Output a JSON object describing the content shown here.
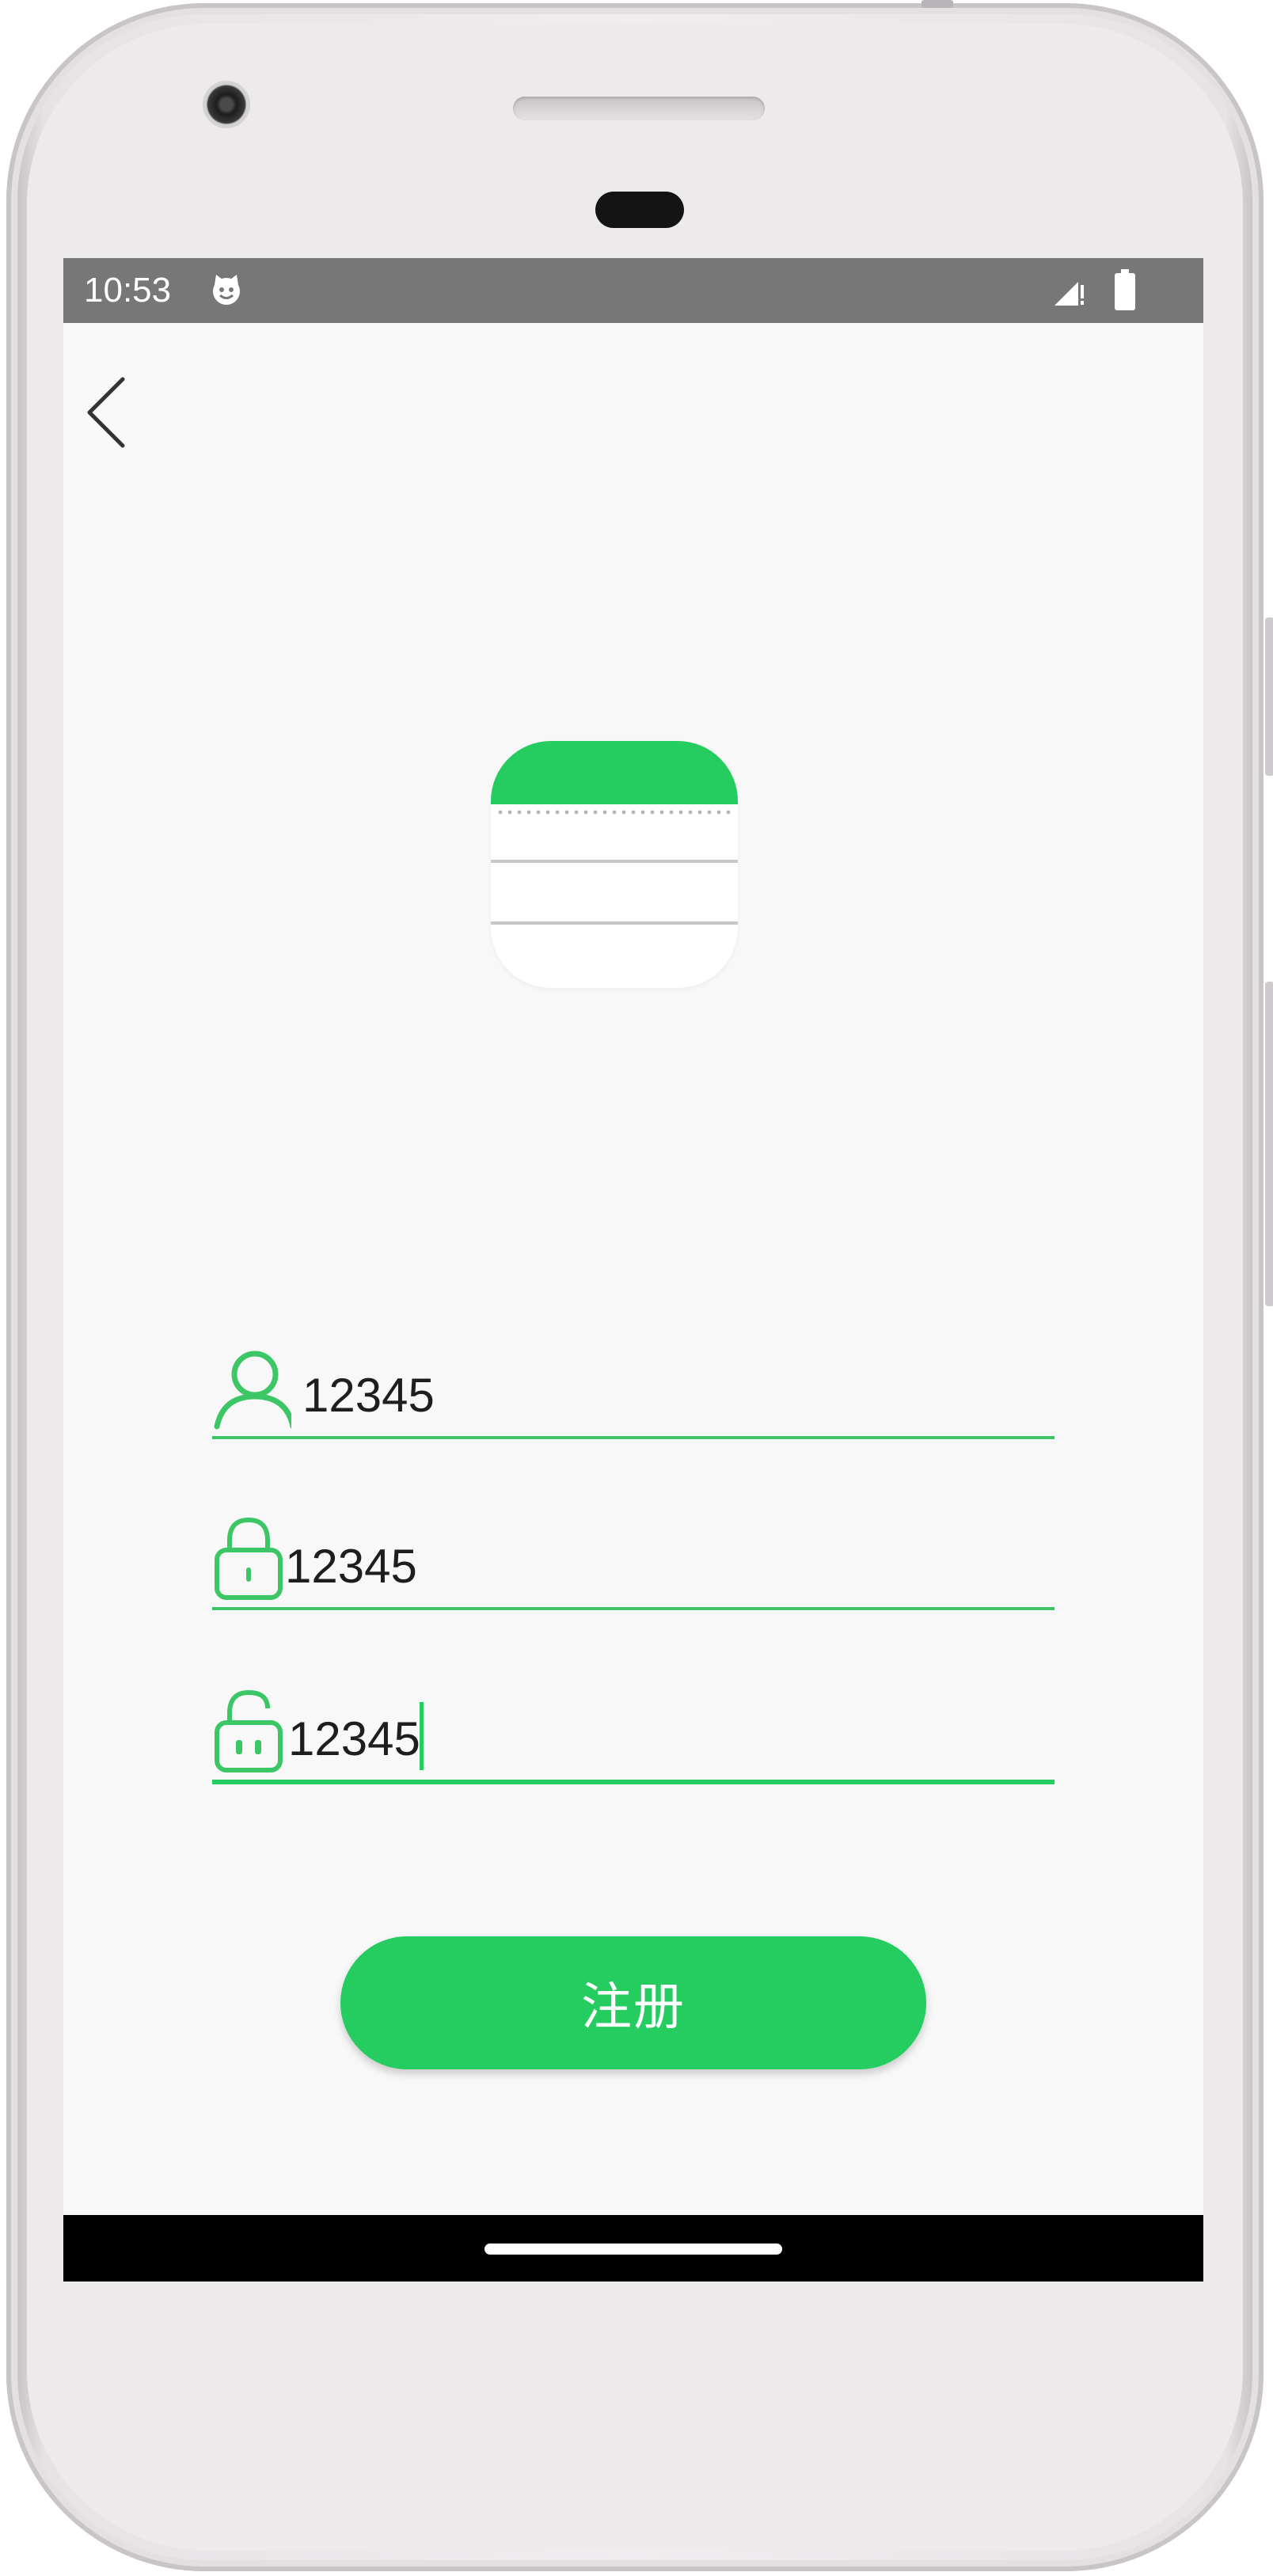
{
  "status_bar": {
    "time": "10:53",
    "notification_icon": "smiley-cat-icon",
    "signal_icon": "signal-icon",
    "battery_icon": "battery-icon"
  },
  "nav": {
    "back_icon": "back-arrow-icon"
  },
  "logo": {
    "icon": "notes-app-icon",
    "accent": "#25cd60"
  },
  "form": {
    "username": {
      "icon": "user-icon",
      "value": "12345"
    },
    "password": {
      "icon": "lock-icon",
      "value": "12345"
    },
    "confirm_password": {
      "icon": "unlock-icon",
      "value": "12345"
    }
  },
  "register_button": {
    "label": "注册"
  },
  "colors": {
    "accent": "#25cd60",
    "status_bar": "#777777",
    "background": "#f8f8f8"
  }
}
